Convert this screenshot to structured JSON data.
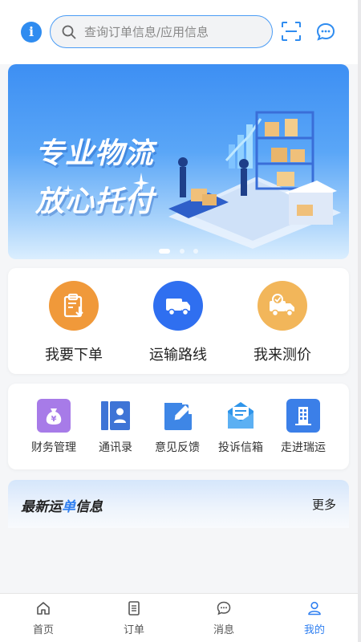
{
  "header": {
    "search_placeholder": "查询订单信息/应用信息",
    "icons": [
      "info-icon",
      "search-icon",
      "scan-icon",
      "chat-icon"
    ]
  },
  "banner": {
    "line1": "专业物流",
    "line2": "放心托付",
    "slide_count": 3,
    "active_slide": 1
  },
  "main_services": [
    {
      "label": "我要下单",
      "icon": "order-clipboard-icon",
      "color": "#f0993a"
    },
    {
      "label": "运输路线",
      "icon": "truck-icon",
      "color": "#2f6ff0"
    },
    {
      "label": "我来测价",
      "icon": "price-truck-icon",
      "color": "#f2b65a"
    }
  ],
  "sub_services": [
    {
      "label": "财务管理",
      "icon": "money-bag-icon",
      "color": "#a77be8"
    },
    {
      "label": "通讯录",
      "icon": "contacts-icon",
      "color": "#3e74d6"
    },
    {
      "label": "意见反馈",
      "icon": "feedback-edit-icon",
      "color": "#3e86e6"
    },
    {
      "label": "投诉信箱",
      "icon": "mailbox-icon",
      "color": "#2f95ea"
    },
    {
      "label": "走进瑞运",
      "icon": "building-icon",
      "color": "#3b7fe8"
    }
  ],
  "news": {
    "title_part1": "最新运",
    "title_highlight": "单",
    "title_part2": "信息",
    "more_label": "更多"
  },
  "bottom_nav": [
    {
      "label": "首页",
      "icon": "home-icon",
      "active": false
    },
    {
      "label": "订单",
      "icon": "order-list-icon",
      "active": false
    },
    {
      "label": "消息",
      "icon": "message-icon",
      "active": false
    },
    {
      "label": "我的",
      "icon": "profile-icon",
      "active": true
    }
  ],
  "colors": {
    "accent": "#2f7ff0",
    "search_border": "#4a9cf5"
  }
}
